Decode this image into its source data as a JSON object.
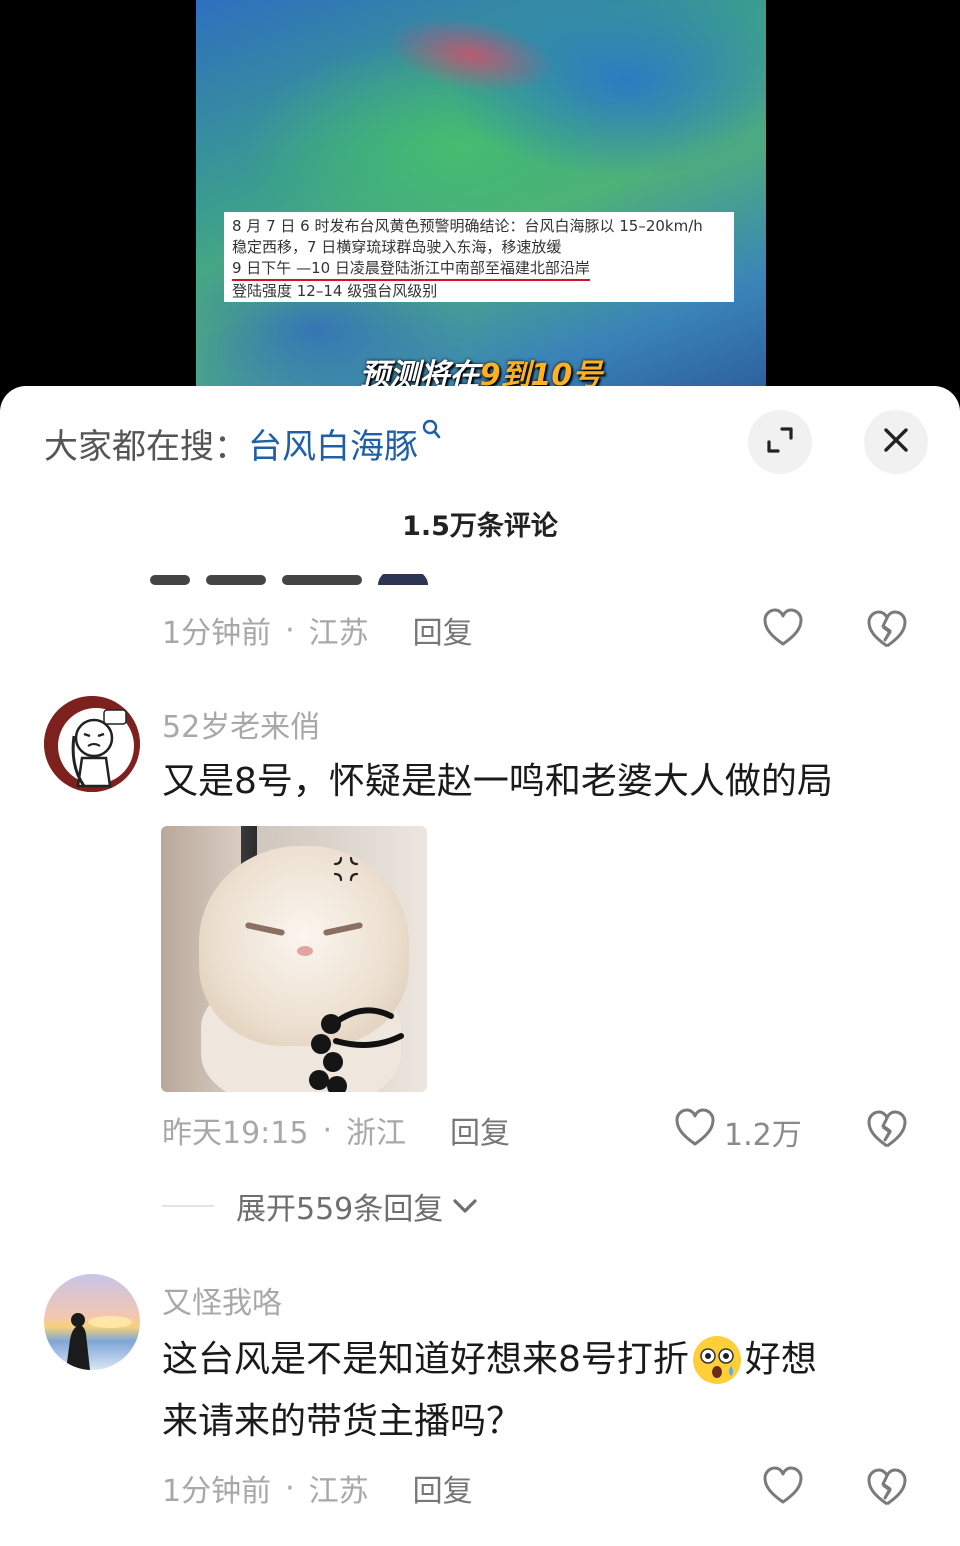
{
  "video": {
    "notice_line1": "8 月 7 日 6 时发布台风黄色预警明确结论：台风白海豚以 15–20km/h",
    "notice_line2": "稳定西移，7 日横穿琉球群岛驶入东海，移速放缓",
    "notice_line3": "9 日下午 —10 日凌晨登陆浙江中南部至福建北部沿岸",
    "notice_line4": "登陆强度 12–14 级强台风级别",
    "caption_prefix": "预测将在",
    "caption_highlight": "9到10号"
  },
  "panel": {
    "search_prefix": "大家都在搜：",
    "search_term": "台风白海豚",
    "comment_count_title": "1.5万条评论",
    "icons": [
      "expand-icon",
      "close-icon",
      "heart-icon",
      "broken-heart-icon",
      "chevron-down-icon"
    ]
  },
  "comments": [
    {
      "time": "1分钟前",
      "location": "江苏",
      "reply_label": "回复"
    },
    {
      "username": "52岁老来俏",
      "text": "又是8号，怀疑是赵一鸣和老婆大人做的局",
      "time": "昨天19:15",
      "location": "浙江",
      "reply_label": "回复",
      "likes": "1.2万",
      "expand_replies": "展开559条回复"
    },
    {
      "username": "又怪我咯",
      "text_line1": "这台风是不是知道好想来8号打折",
      "text_line1b": "好想",
      "text_line2": "来请来的带货主播吗？",
      "time": "1分钟前",
      "location": "江苏",
      "reply_label": "回复"
    }
  ],
  "meta_separator": "·"
}
